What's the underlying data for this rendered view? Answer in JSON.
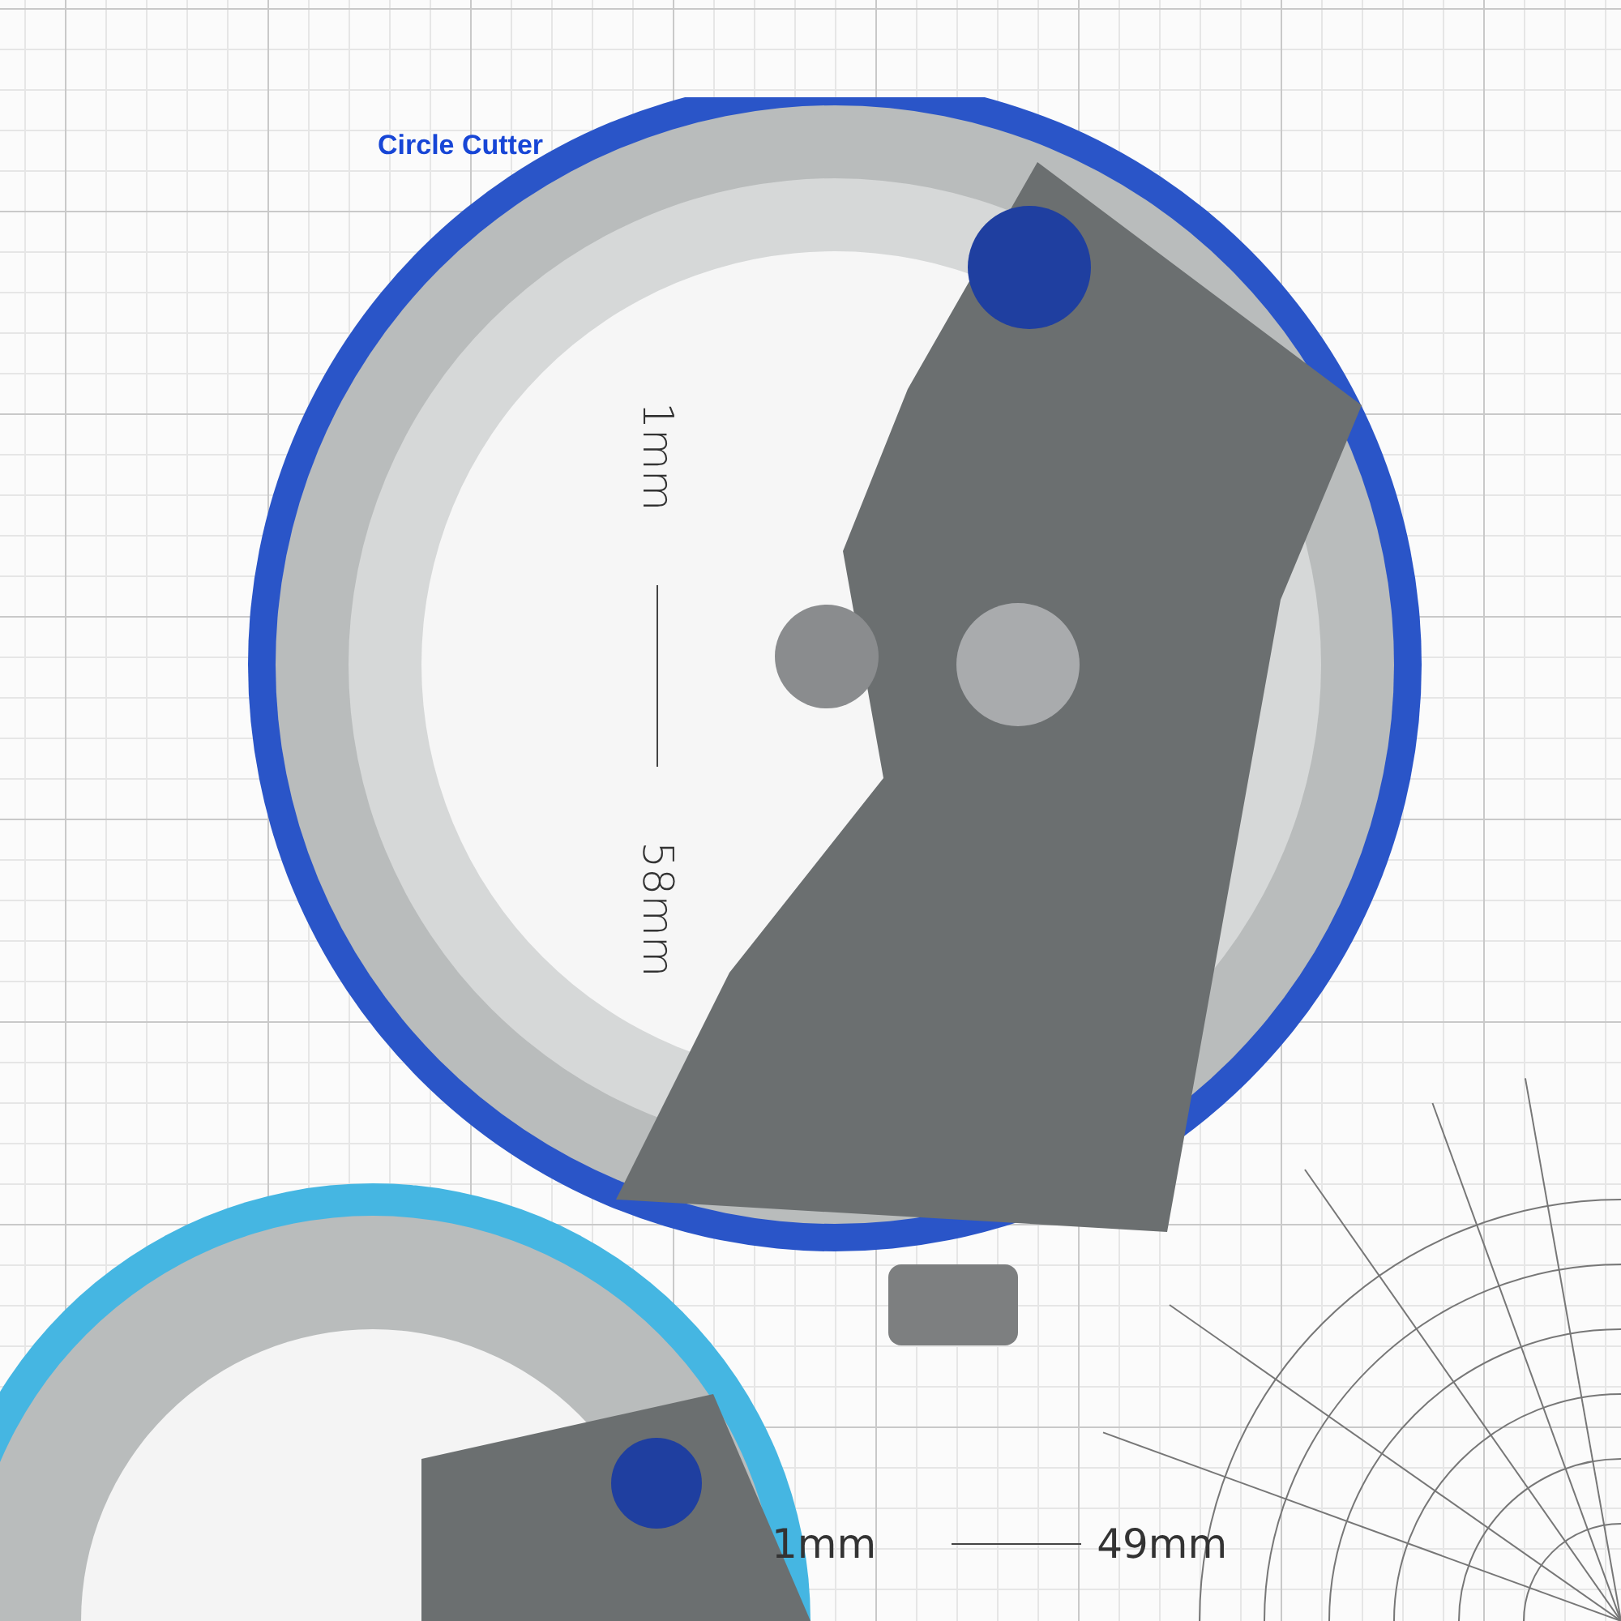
{
  "title": "Circle Cutter",
  "size_range_vertical": {
    "min": "1mm",
    "max": "58mm"
  },
  "size_range_horizontal": {
    "min": "1mm",
    "max": "49mm"
  }
}
